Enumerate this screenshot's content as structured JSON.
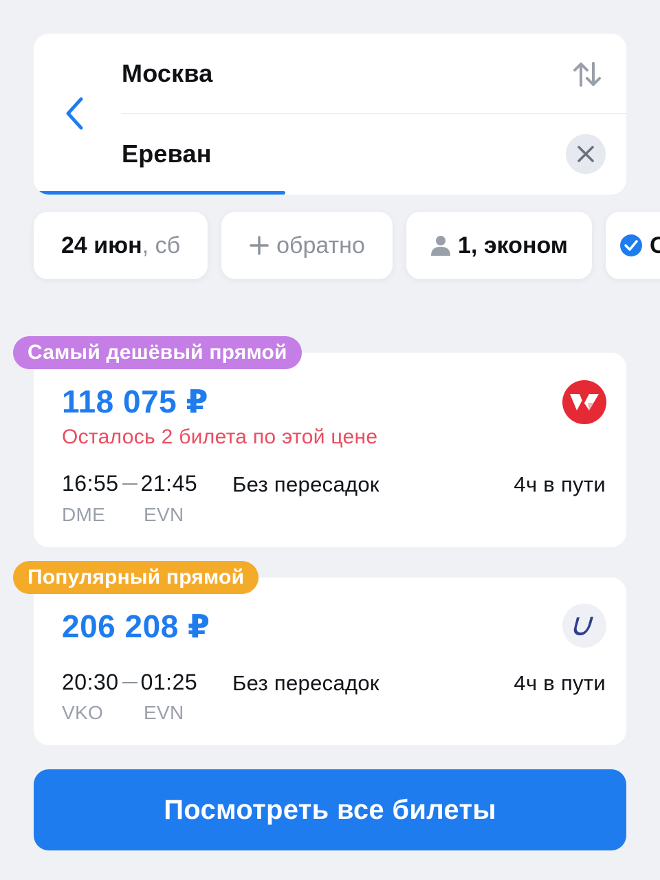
{
  "search": {
    "origin": "Москва",
    "destination": "Ереван"
  },
  "filters": {
    "date_main": "24 июн",
    "date_weekday": ", сб",
    "return_label": "обратно",
    "passengers_label": "1, эконом",
    "extra_partial": "С"
  },
  "tickets": [
    {
      "badge": "Самый дешёвый прямой",
      "badge_color": "#c47ee6",
      "price": "118 075 ₽",
      "warning": "Осталось 2 билета по этой цене",
      "departure_time": "16:55",
      "arrival_time": "21:45",
      "departure_airport": "DME",
      "arrival_airport": "EVN",
      "stops": "Без пересадок",
      "duration": "4ч в пути",
      "airline_logo": "red-wing-logo-icon"
    },
    {
      "badge": "Популярный прямой",
      "badge_color": "#f5ab2a",
      "price": "206 208 ₽",
      "departure_time": "20:30",
      "arrival_time": "01:25",
      "departure_airport": "VKO",
      "arrival_airport": "EVN",
      "stops": "Без пересадок",
      "duration": "4ч в пути",
      "airline_logo": "blue-u-logo-icon"
    }
  ],
  "actions": {
    "view_all_label": "Посмотреть все билеты"
  },
  "colors": {
    "accent": "#1f7cee",
    "warning": "#ea4d60",
    "background": "#eff1f5"
  }
}
